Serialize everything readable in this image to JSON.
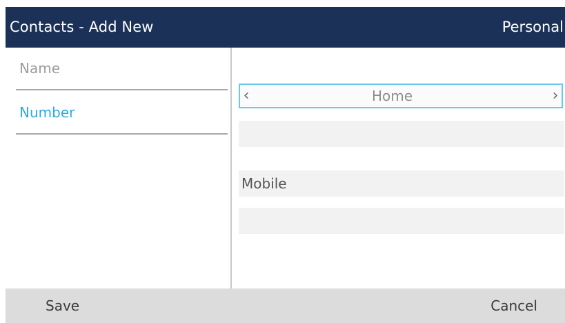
{
  "header": {
    "title": "Contacts - Add New",
    "context": "Personal"
  },
  "fields": [
    {
      "label": "Name",
      "selected": false
    },
    {
      "label": "Number",
      "selected": true
    }
  ],
  "number_panel": {
    "type_selector": {
      "value": "Home",
      "left_arrow": "‹",
      "right_arrow": "›"
    },
    "home_value": "",
    "second_label_value": "Mobile",
    "mobile_value": ""
  },
  "softkeys": {
    "save_label": "Save",
    "cancel_label": "Cancel"
  },
  "colors": {
    "header_bg": "#1b3157",
    "selected_text": "#2baae2",
    "focus_border": "#6cc7ec",
    "softkey_bar": "#dcdcdc"
  },
  "icons": {
    "left_arrow": "chevron-left-icon",
    "right_arrow": "chevron-right-icon"
  }
}
